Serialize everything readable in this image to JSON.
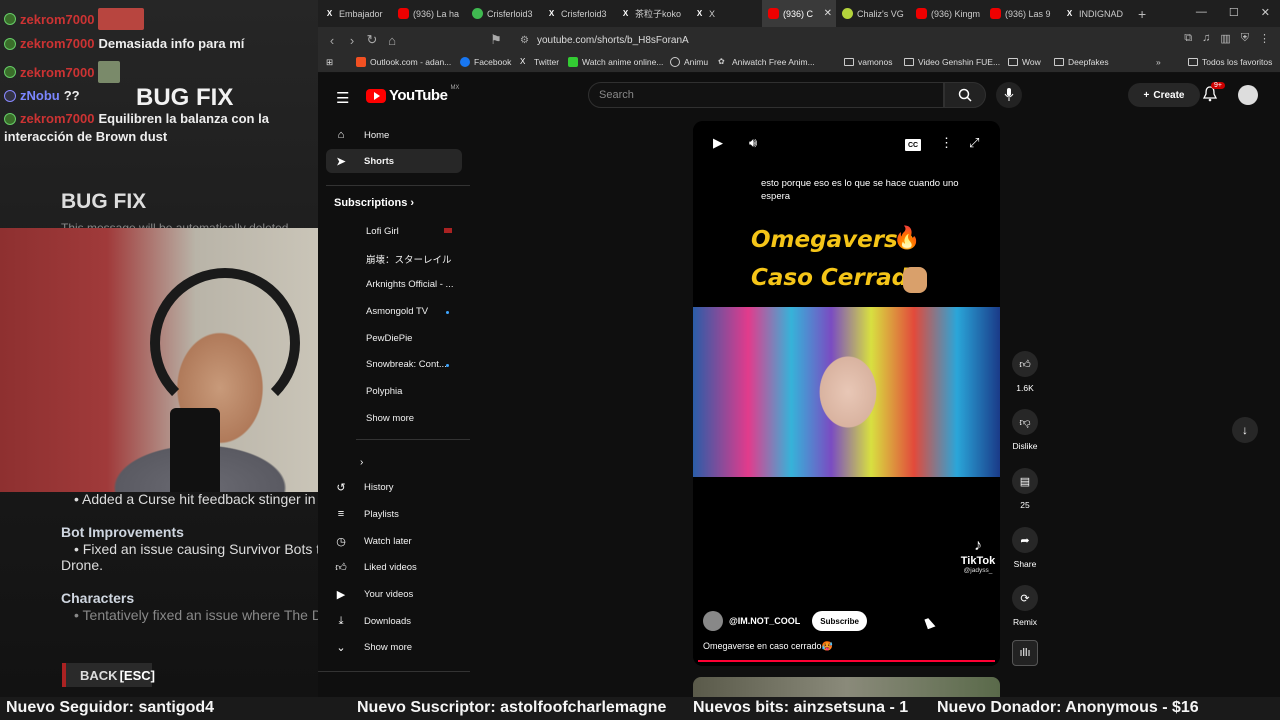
{
  "overlay": {
    "chat": [
      {
        "user": "zekrom7000",
        "msg": ""
      },
      {
        "user": "zekrom7000",
        "msg": "Demasiada info para mí"
      },
      {
        "user": "zekrom7000",
        "msg": ""
      },
      {
        "user": "zNobu",
        "msg": "??"
      },
      {
        "user": "zekrom7000",
        "msg": "Equilibren la balanza con la"
      }
    ],
    "chat_wrap": "interacción de Brown dust",
    "bugfix_small": "BUG FIX",
    "bugfix_big": "BUG FIX",
    "deleted": "This message will be automatically deleted",
    "patch_lines": [
      "• Added a Curse hit feedback stinger in",
      "Bot Improvements",
      "• Fixed an issue causing Survivor Bots t",
      "Drone.",
      "Characters",
      "• Tentatively fixed an issue where The D"
    ],
    "back_label": "BACK",
    "back_key": "[ESC]"
  },
  "ticker": [
    "Nuevo Seguidor: santigod4",
    "Nuevo Suscriptor: astolfoofcharlemagne",
    "Nuevos bits: ainzsetsuna - 1",
    "Nuevo Donador: Anonymous - $16"
  ],
  "browser": {
    "tabs": [
      {
        "label": "Embajador",
        "icon": "x"
      },
      {
        "label": "(936) La ha",
        "icon": "yt"
      },
      {
        "label": "Crisferloid3",
        "icon": "g"
      },
      {
        "label": "Crisferloid3",
        "icon": "x"
      },
      {
        "label": "茶粒子koko",
        "icon": "x"
      },
      {
        "label": "X",
        "icon": "x"
      },
      {
        "label": "(936) C",
        "icon": "yt",
        "active": true
      },
      {
        "label": "Chaliz's VG",
        "icon": "l"
      },
      {
        "label": "(936) Kingm",
        "icon": "yt"
      },
      {
        "label": "(936) Las 9",
        "icon": "yt"
      },
      {
        "label": "INDIGNAD",
        "icon": "x"
      }
    ],
    "url": "youtube.com/shorts/b_H8sForanA",
    "bookmarks": [
      "Outlook.com - adan...",
      "Facebook",
      "Twitter",
      "Watch anime online...",
      "Animu",
      "Aniwatch Free Anim...",
      "vamonos",
      "Video Genshin FUE...",
      "Wow",
      "Deepfakes",
      "Todos los favoritos"
    ]
  },
  "youtube": {
    "logo": "YouTube",
    "country": "MX",
    "search_placeholder": "Search",
    "create": "Create",
    "notif_count": "9+",
    "nav": [
      "Home",
      "Shorts"
    ],
    "subscriptions_label": "Subscriptions",
    "subscriptions": [
      "Lofi Girl",
      "崩壊：スターレイル",
      "Arknights Official - ...",
      "Asmongold TV",
      "PewDiePie",
      "Snowbreak: Cont...",
      "Polyphia",
      "Show more"
    ],
    "you_items": [
      "History",
      "Playlists",
      "Watch later",
      "Liked videos",
      "Your videos",
      "Downloads",
      "Show more"
    ],
    "short": {
      "caption": "esto porque eso es lo que se hace cuando uno espera",
      "title1": "Omegaverse",
      "title2": "Caso Cerrado",
      "tiktok": "TikTok",
      "tiktok_handle": "@jadyss_",
      "channel": "@IM.NOT_COOL",
      "subscribe": "Subscribe",
      "description": "Omegaverse en caso cerrado🥵"
    },
    "actions": {
      "likes": "1.6K",
      "dislike": "Dislike",
      "comments": "25",
      "share": "Share",
      "remix": "Remix"
    }
  }
}
